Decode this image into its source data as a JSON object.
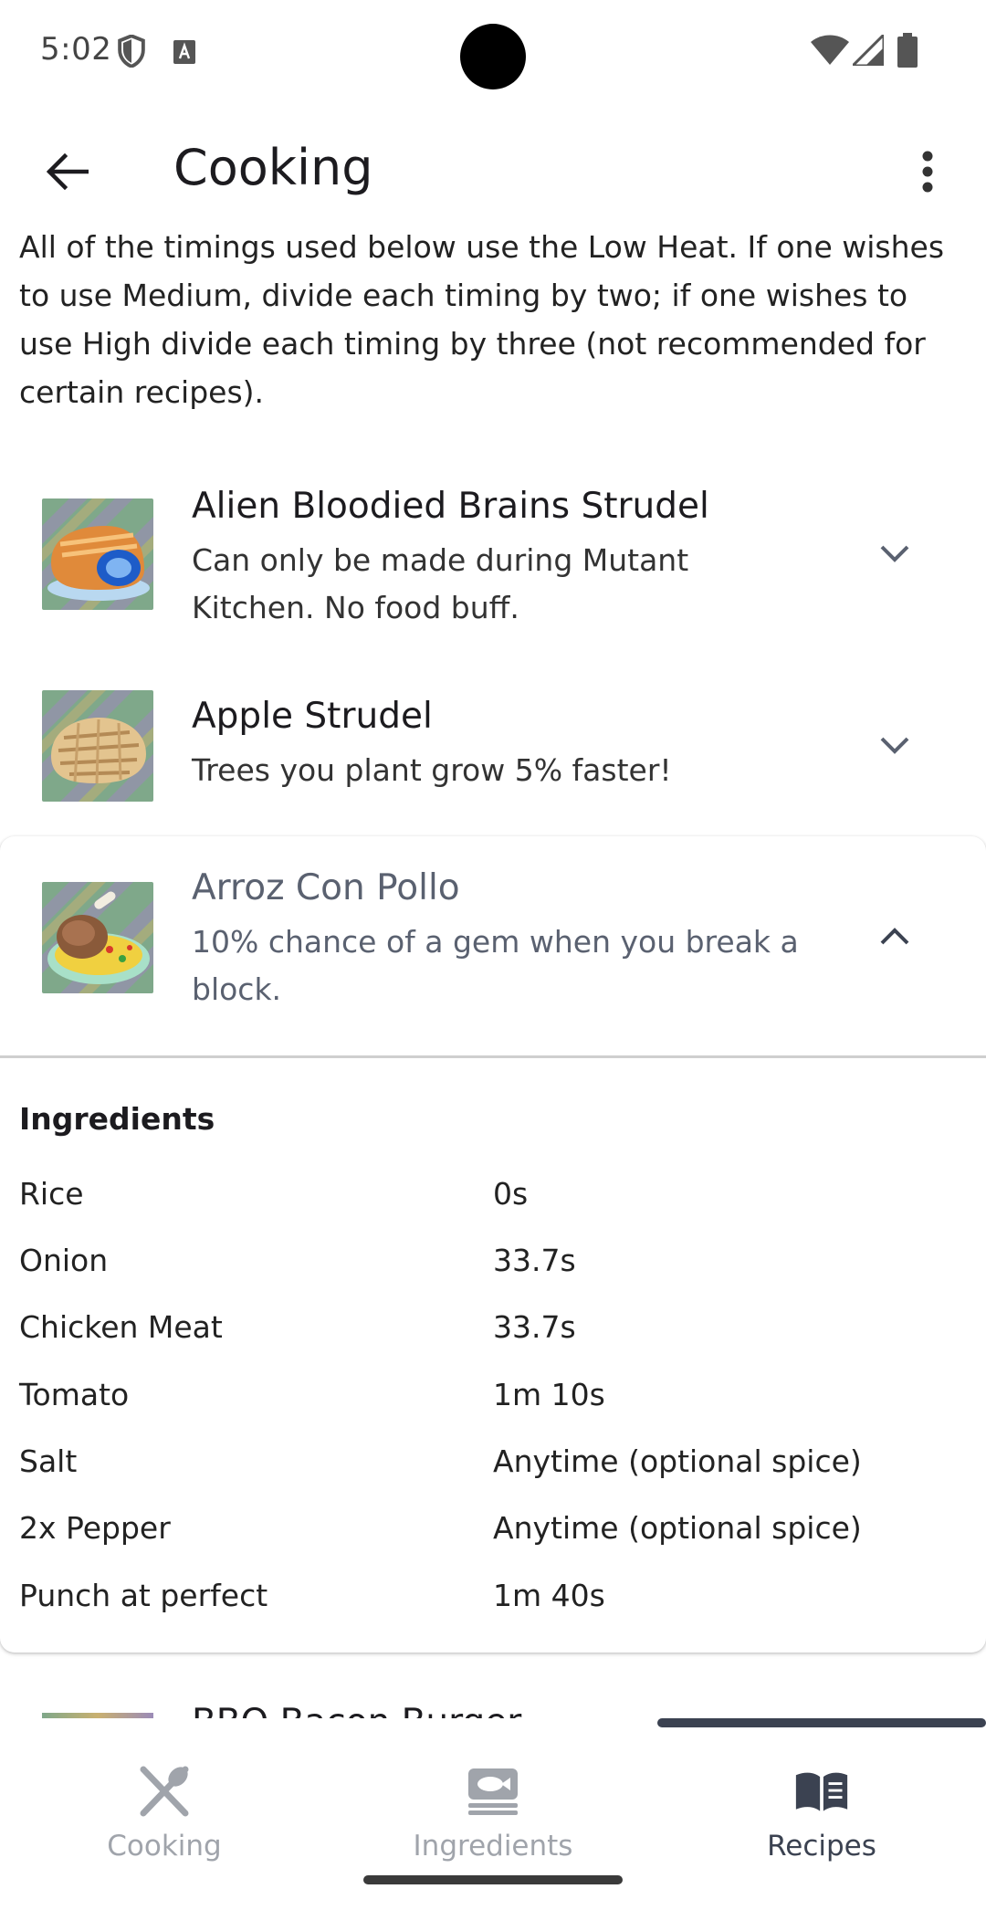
{
  "status_bar": {
    "time": "5:02",
    "icons": [
      "shield-icon",
      "accessibility-a-icon",
      "wifi-icon",
      "signal-icon",
      "battery-icon"
    ]
  },
  "app_bar": {
    "title": "Cooking",
    "back_icon": "arrow-back-icon",
    "menu_icon": "more-vert-icon"
  },
  "intro": "All of the timings used below use the Low Heat. If one wishes to use Medium, divide each timing by two; if one wishes to use High divide each timing by three (not recommended for certain recipes).",
  "recipes": [
    {
      "title": "Alien Bloodied Brains Strudel",
      "description": "Can only be made during Mutant Kitchen.  No food buff.",
      "expanded": false
    },
    {
      "title": "Apple Strudel",
      "description": "Trees you plant grow 5% faster!",
      "expanded": false
    },
    {
      "title": "Arroz Con Pollo",
      "description": "10% chance of a gem when you break a block.",
      "expanded": true,
      "ingredients_heading": "Ingredients",
      "ingredients": [
        {
          "name": "Rice",
          "time": "0s"
        },
        {
          "name": "Onion",
          "time": "33.7s"
        },
        {
          "name": "Chicken Meat",
          "time": "33.7s"
        },
        {
          "name": "Tomato",
          "time": "1m 10s"
        },
        {
          "name": "Salt",
          "time": "Anytime (optional spice)"
        },
        {
          "name": "2x Pepper",
          "time": "Anytime (optional spice)"
        },
        {
          "name": "Punch at perfect",
          "time": "1m 40s"
        }
      ]
    },
    {
      "title": "BBQ Bacon Burger",
      "expanded": false
    }
  ],
  "bottom_nav": {
    "items": [
      {
        "label": "Cooking",
        "icon": "utensils-icon",
        "active": false
      },
      {
        "label": "Ingredients",
        "icon": "ingredients-icon",
        "active": false
      },
      {
        "label": "Recipes",
        "icon": "book-icon",
        "active": true
      }
    ]
  },
  "colors": {
    "accent": "#3b4251",
    "inactive": "#a0a4ab",
    "text": "#1c1b1f"
  }
}
